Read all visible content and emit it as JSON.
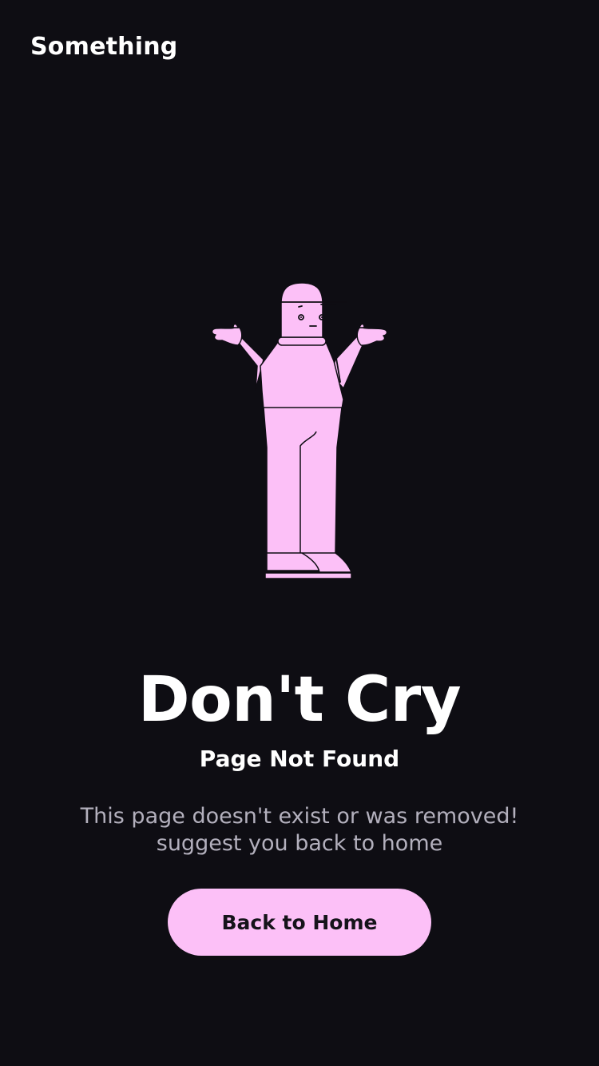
{
  "header": {
    "brand": "Something"
  },
  "illustration": {
    "icon": "shrugging-person-illustration",
    "fill_color": "#fcc0f7",
    "line_color": "#0e0d13"
  },
  "error": {
    "title": "Don't Cry",
    "subtitle": "Page Not Found",
    "message_line1": "This page doesn't exist or was removed!",
    "message_line2": "suggest you back to home"
  },
  "actions": {
    "home_label": "Back to Home"
  },
  "colors": {
    "background": "#0e0d13",
    "accent": "#fcc0f7",
    "muted_text": "#b3b0bd"
  }
}
